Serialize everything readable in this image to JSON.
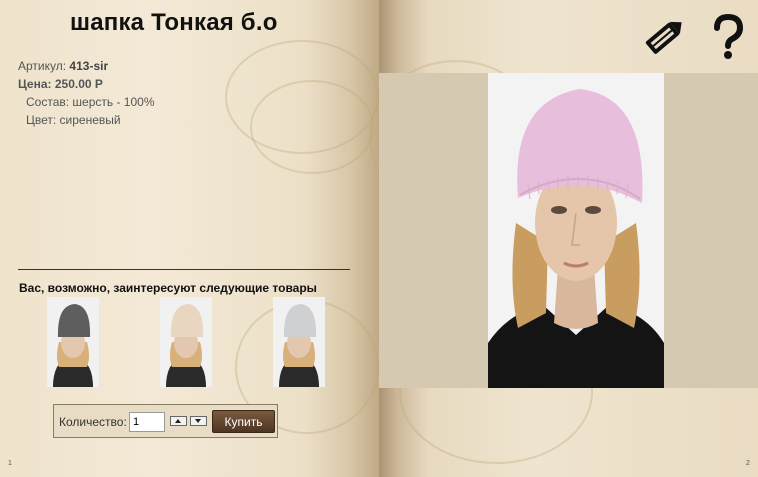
{
  "product": {
    "title": "шапка Тонкая б.о",
    "sku_label": "Артикул:",
    "sku": "413-sir",
    "price_label": "Цена:",
    "price": "250.00 Р",
    "composition": "Состав: шерсть - 100%",
    "color": "Цвет: сиреневый"
  },
  "recommendations": {
    "title": "Вас, возможно, заинтересуют следующие товары",
    "items": [
      {
        "hat_color": "#5e5e5e",
        "name": "recommendation-dark-grey-hat"
      },
      {
        "hat_color": "#e8d6c0",
        "name": "recommendation-beige-hat"
      },
      {
        "hat_color": "#cfd0d2",
        "name": "recommendation-light-grey-hat"
      }
    ]
  },
  "purchase": {
    "quantity_label": "Количество:",
    "quantity_value": "1",
    "buy_label": "Купить"
  },
  "pages": {
    "left": "1",
    "right": "2"
  },
  "icons": {
    "edit": "pencil-icon",
    "help": "question-mark-icon"
  },
  "colors": {
    "main_hat": "#e7bedb",
    "button": "#5e4330"
  }
}
